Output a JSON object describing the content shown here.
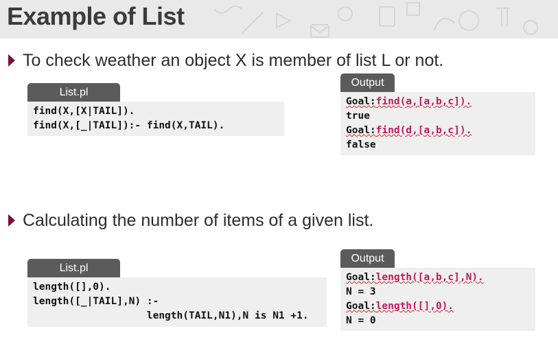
{
  "slide": {
    "title": "Example of List"
  },
  "section1": {
    "bullet": "To check weather an object X is member of list L or not.",
    "code_tab": "List.pl",
    "code_lines": [
      "find(X,[X|TAIL]).",
      "find(X,[_|TAIL]):- find(X,TAIL)."
    ],
    "output_tab": "Output",
    "output": {
      "goal1_prefix": "Goal:",
      "goal1_query": "find(a,[a,b,c]).",
      "result1": "true",
      "goal2_prefix": "Goal:",
      "goal2_query": "find(d,[a,b,c]).",
      "result2": "false"
    }
  },
  "section2": {
    "bullet": "Calculating the number of items of a given list.",
    "code_tab": "List.pl",
    "code_lines": [
      "length([],0).",
      "length([_|TAIL],N) :-",
      "                   length(TAIL,N1),N is N1 +1."
    ],
    "output_tab": "Output",
    "output": {
      "goal1_prefix": "Goal:",
      "goal1_query": "length([a,b,c],N).",
      "result1": "N = 3",
      "goal2_prefix": "Goal:",
      "goal2_query": "length([],0).",
      "result2": "N = 0"
    }
  },
  "colors": {
    "bullet_arrow": "#7b0e38",
    "tab_bg": "#5b5b5b",
    "code_bg": "#efefef",
    "query_color": "#c2185b"
  }
}
